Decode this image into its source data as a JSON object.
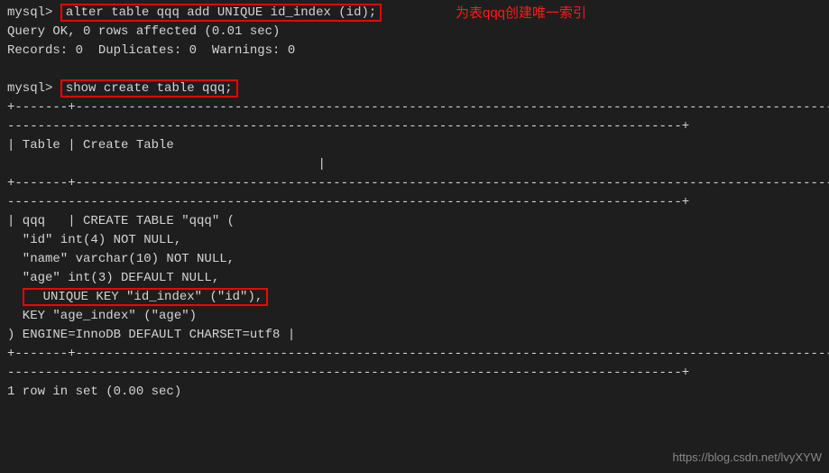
{
  "prompt": "mysql>",
  "cmd1": "alter table qqq add UNIQUE id_index (id);",
  "annotation1": "为表qqq创建唯一索引",
  "resp1_line1": "Query OK, 0 rows affected (0.01 sec)",
  "resp1_line2": "Records: 0  Duplicates: 0  Warnings: 0",
  "cmd2": "show create table qqq;",
  "sep_top": "+-------+---------------------------------------------------------------------------------------------------------",
  "sep_dash": "-----------------------------------------------------------------------------------------+",
  "header_line": "| Table | Create Table",
  "header_end": "                                         |",
  "sep_mid": "+-------+---------------------------------------------------------------------------------------------------------",
  "body_line1": "| qqq   | CREATE TABLE \"qqq\" (",
  "body_line2": "  \"id\" int(4) NOT NULL,",
  "body_line3": "  \"name\" varchar(10) NOT NULL,",
  "body_line4": "  \"age\" int(3) DEFAULT NULL,",
  "body_line5": "  UNIQUE KEY \"id_index\" (\"id\"),",
  "body_line6": "  KEY \"age_index\" (\"age\")",
  "body_line7": ") ENGINE=InnoDB DEFAULT CHARSET=utf8 |",
  "footer": "1 row in set (0.00 sec)",
  "watermark": "https://blog.csdn.net/lvyXYW"
}
